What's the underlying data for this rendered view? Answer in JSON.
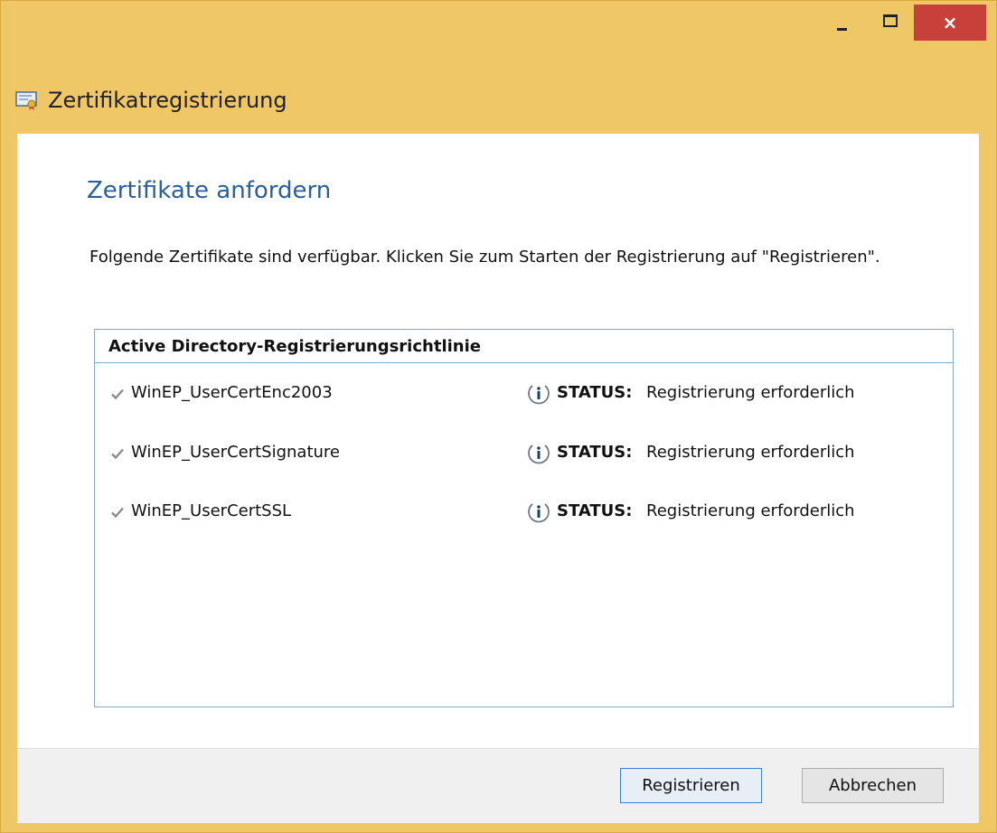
{
  "window": {
    "title": "Zertifikatregistrierung",
    "controls": {
      "close_glyph": "×"
    }
  },
  "page": {
    "heading": "Zertifikate anfordern",
    "description": "Folgende Zertifikate sind verfügbar. Klicken Sie zum Starten der Registrierung auf \"Registrieren\"."
  },
  "policy": {
    "header": "Active Directory-Registrierungsrichtlinie",
    "items": [
      {
        "name": "WinEP_UserCertEnc2003",
        "checked": true,
        "status_key": "STATUS:",
        "status_value": "Registrierung erforderlich"
      },
      {
        "name": "WinEP_UserCertSignature",
        "checked": true,
        "status_key": "STATUS:",
        "status_value": "Registrierung erforderlich"
      },
      {
        "name": "WinEP_UserCertSSL",
        "checked": true,
        "status_key": "STATUS:",
        "status_value": "Registrierung erforderlich"
      }
    ]
  },
  "footer": {
    "register_label": "Registrieren",
    "cancel_label": "Abbrechen"
  },
  "colors": {
    "titlebar": "#f0c766",
    "close_button": "#c7413a",
    "heading": "#2a5f9c",
    "list_border": "#87a8c9"
  },
  "icons": {
    "app": "certificate-icon",
    "status": "info-icon",
    "check": "checkmark-icon"
  }
}
